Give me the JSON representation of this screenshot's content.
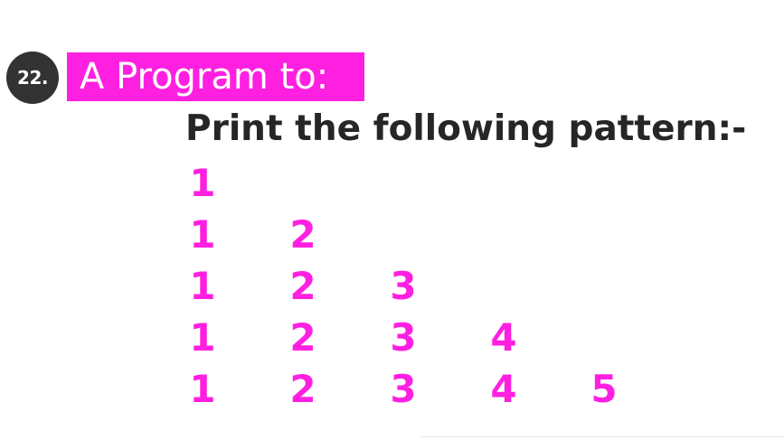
{
  "badge": {
    "number": "22."
  },
  "heading": {
    "title": "A Program to:",
    "subtitle": "Print the following pattern:-"
  },
  "pattern": {
    "rows": [
      [
        "1"
      ],
      [
        "1",
        "2"
      ],
      [
        "1",
        "2",
        "3"
      ],
      [
        "1",
        "2",
        "3",
        "4"
      ],
      [
        "1",
        "2",
        "3",
        "4",
        "5"
      ]
    ]
  },
  "colors": {
    "accent": "#ff1fe1",
    "badge_bg": "#333333",
    "subtitle_text": "#262626",
    "background": "#ffffff"
  }
}
